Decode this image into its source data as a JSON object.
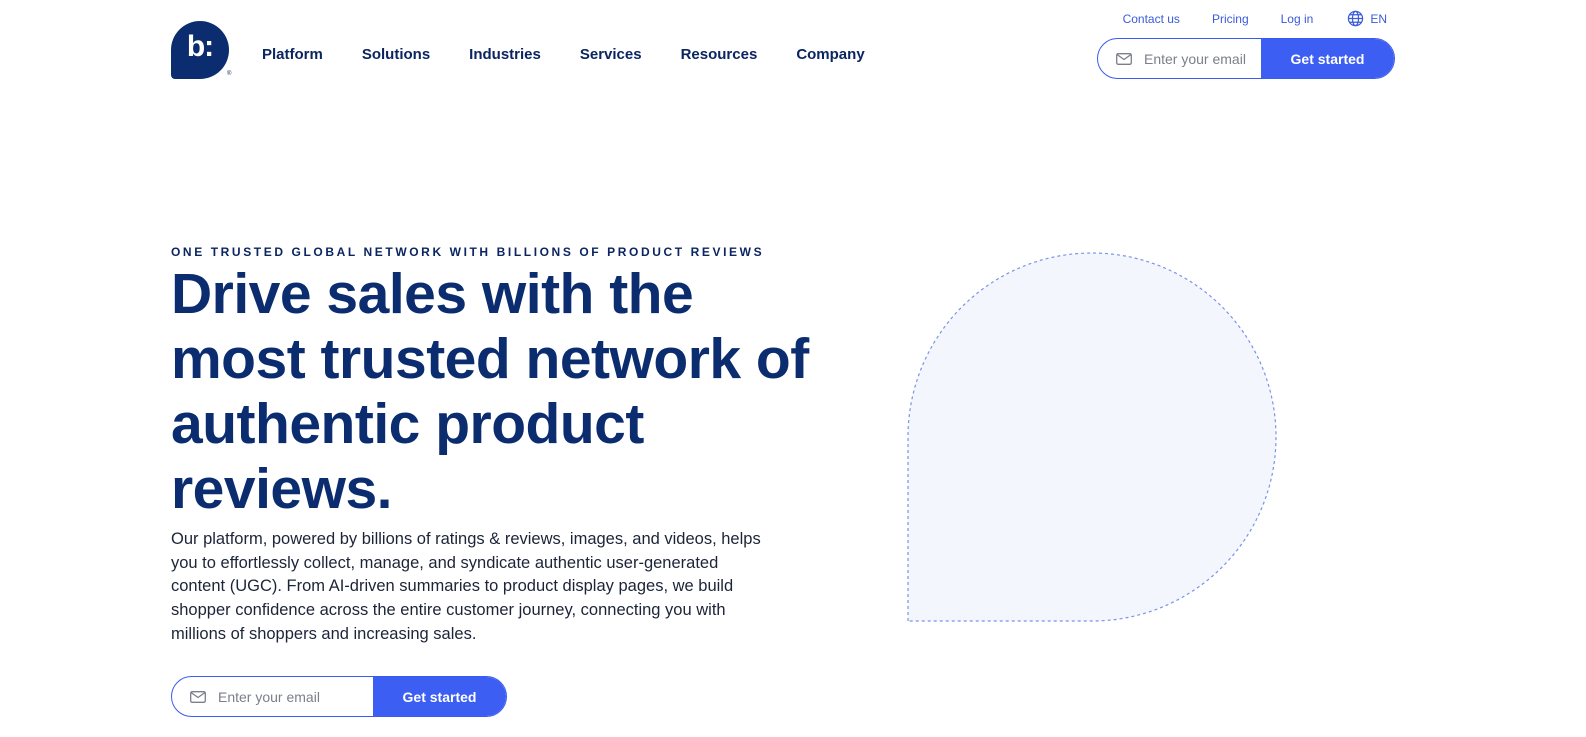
{
  "logo": {
    "glyph": "b:",
    "reg_mark": "®"
  },
  "nav": {
    "items": [
      {
        "label": "Platform",
        "name": "nav-item-platform"
      },
      {
        "label": "Solutions",
        "name": "nav-item-solutions"
      },
      {
        "label": "Industries",
        "name": "nav-item-industries"
      },
      {
        "label": "Services",
        "name": "nav-item-services"
      },
      {
        "label": "Resources",
        "name": "nav-item-resources"
      },
      {
        "label": "Company",
        "name": "nav-item-company"
      }
    ]
  },
  "utility": {
    "contact": "Contact us",
    "pricing": "Pricing",
    "login": "Log in",
    "language": "EN",
    "language_icon": "globe-icon"
  },
  "header_form": {
    "placeholder": "Enter your email",
    "button": "Get started",
    "icon": "mail-icon"
  },
  "hero": {
    "eyebrow": "ONE TRUSTED GLOBAL NETWORK WITH BILLIONS OF PRODUCT REVIEWS",
    "headline": "Drive sales with the most trusted network of authentic product reviews.",
    "body": "Our platform, powered by billions of ratings & reviews, images, and videos, helps you to effortlessly collect, manage, and syndicate authentic user-generated content (UGC). From AI-driven summaries to product display pages, we build shopper confidence across the entire customer journey, connecting you with millions of shoppers and increasing sales.",
    "form": {
      "placeholder": "Enter your email",
      "button": "Get started",
      "icon": "mail-icon"
    }
  },
  "colors": {
    "brand_navy": "#0b2d6f",
    "accent_blue": "#3d5ef2",
    "bubble_fill": "#f3f6fd",
    "bubble_outline": "#7b93e8"
  }
}
